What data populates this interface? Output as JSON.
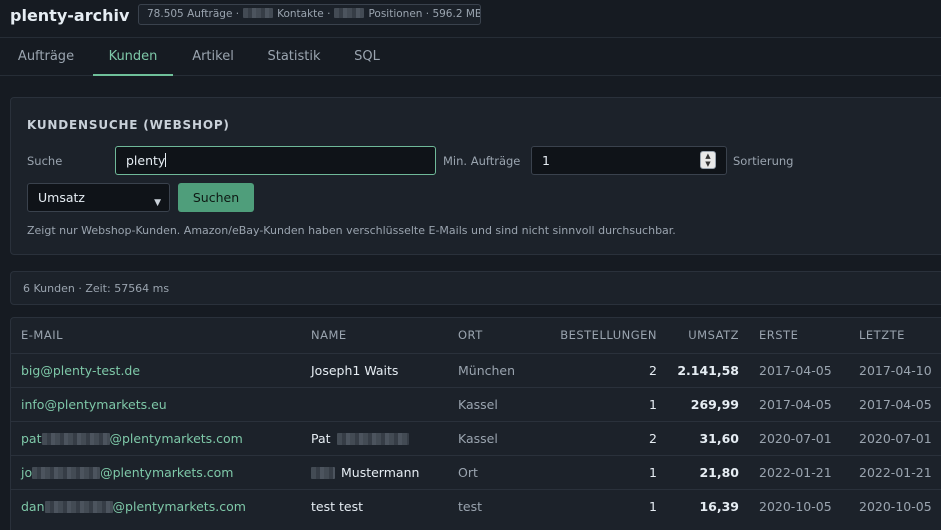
{
  "app": {
    "title": "plenty-archiv",
    "stats": {
      "orders": "78.505 Aufträge ·",
      "contacts": "Kontakte ·",
      "positions": "Positionen · 596.2 MB"
    }
  },
  "nav": {
    "tabs": [
      {
        "label": "Aufträge"
      },
      {
        "label": "Kunden"
      },
      {
        "label": "Artikel"
      },
      {
        "label": "Statistik"
      },
      {
        "label": "SQL"
      }
    ]
  },
  "search": {
    "heading": "KUNDENSUCHE (WEBSHOP)",
    "search_label": "Suche",
    "search_value": "plenty",
    "min_orders_label": "Min. Aufträge",
    "min_orders_value": "1",
    "sort_label": "Sortierung",
    "sort_value": "Umsatz",
    "submit_label": "Suchen",
    "hint": "Zeigt nur Webshop-Kunden. Amazon/eBay-Kunden haben verschlüsselte E-Mails und sind nicht sinnvoll durchsuchbar."
  },
  "status": {
    "text": "6 Kunden · Zeit: 57564 ms"
  },
  "table": {
    "columns": {
      "email": "E-MAIL",
      "name": "NAME",
      "ort": "ORT",
      "bestellungen": "BESTELLUNGEN",
      "umsatz": "UMSATZ",
      "erste": "ERSTE",
      "letzte": "LETZTE"
    },
    "rows": [
      {
        "email_a": "big@plenty-test.de",
        "email_b": "",
        "name_a": "Joseph1 Waits",
        "name_b": "",
        "ort": "München",
        "bestellungen": "2",
        "umsatz": "2.141,58",
        "erste": "2017-04-05",
        "letzte": "2017-04-10"
      },
      {
        "email_a": "info@plentymarkets.eu",
        "email_b": "",
        "name_a": "",
        "name_b": "",
        "ort": "Kassel",
        "bestellungen": "1",
        "umsatz": "269,99",
        "erste": "2017-04-05",
        "letzte": "2017-04-05"
      },
      {
        "email_a": "pat",
        "email_b": "@plentymarkets.com",
        "name_a": "Pat",
        "name_b": "",
        "ort": "Kassel",
        "bestellungen": "2",
        "umsatz": "31,60",
        "erste": "2020-07-01",
        "letzte": "2020-07-01"
      },
      {
        "email_a": "jo",
        "email_b": "@plentymarkets.com",
        "name_a": "",
        "name_b": "Mustermann",
        "ort": "Ort",
        "bestellungen": "1",
        "umsatz": "21,80",
        "erste": "2022-01-21",
        "letzte": "2022-01-21"
      },
      {
        "email_a": "dan",
        "email_b": "@plentymarkets.com",
        "name_a": "test test",
        "name_b": "",
        "ort": "test",
        "bestellungen": "1",
        "umsatz": "16,39",
        "erste": "2020-10-05",
        "letzte": "2020-10-05"
      }
    ]
  },
  "colors": {
    "accent": "#7ec8a8",
    "button": "#4f9e7b",
    "background": "#161b22",
    "panel": "#1c222a"
  }
}
